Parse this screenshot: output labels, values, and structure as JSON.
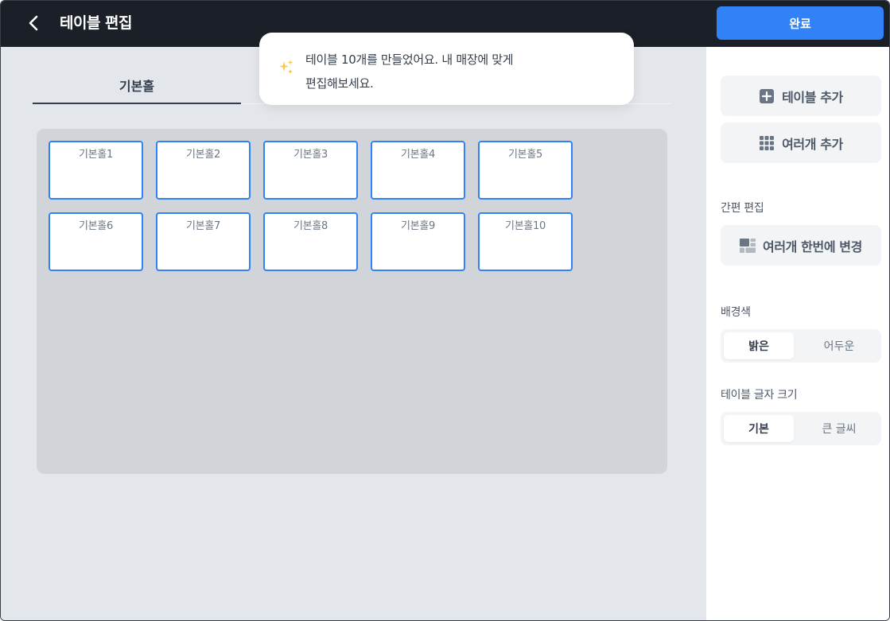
{
  "header": {
    "title": "테이블 편집",
    "done_label": "완료"
  },
  "tabs": [
    {
      "label": "기본홀",
      "active": true
    }
  ],
  "toast": {
    "icon": "sparkles-icon",
    "line1": "테이블 10개를 만들었어요. 내 매장에 맞게",
    "line2": "편집해보세요."
  },
  "tables": [
    {
      "label": "기본홀1"
    },
    {
      "label": "기본홀2"
    },
    {
      "label": "기본홀3"
    },
    {
      "label": "기본홀4"
    },
    {
      "label": "기본홀5"
    },
    {
      "label": "기본홀6"
    },
    {
      "label": "기본홀7"
    },
    {
      "label": "기본홀8"
    },
    {
      "label": "기본홀9"
    },
    {
      "label": "기본홀10"
    }
  ],
  "sidebar": {
    "add_table": "테이블 추가",
    "add_multiple": "여러개 추가",
    "quick_edit_label": "간편 편집",
    "bulk_change": "여러개 한번에 변경",
    "background_label": "배경색",
    "background_options": [
      "밝은",
      "어두운"
    ],
    "background_selected": "밝은",
    "font_size_label": "테이블 글자 크기",
    "font_size_options": [
      "기본",
      "큰 글씨"
    ],
    "font_size_selected": "기본"
  },
  "colors": {
    "accent": "#3182f6",
    "header_bg": "#1b2028",
    "canvas_bg": "#d1d5da"
  }
}
